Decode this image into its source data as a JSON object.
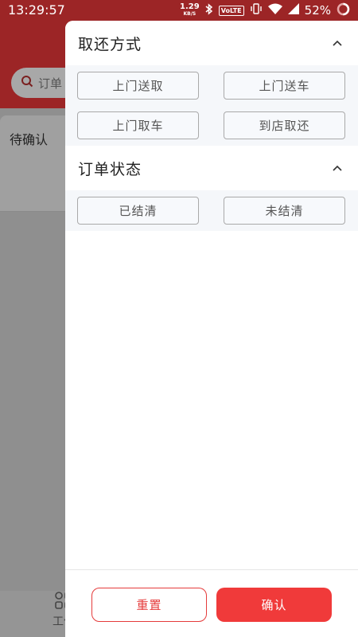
{
  "status_bar": {
    "time": "13:29:57",
    "net_speed": "1.29",
    "net_unit": "KB/S",
    "volte": "VoLTE",
    "battery": "52%"
  },
  "background": {
    "search_placeholder": "订单",
    "tab_label": "待确认",
    "nav_label": "工作"
  },
  "drawer": {
    "sections": [
      {
        "title": "取还方式",
        "options": [
          "上门送取",
          "上门送车",
          "上门取车",
          "到店取还"
        ]
      },
      {
        "title": "订单状态",
        "options": [
          "已结清",
          "未结清"
        ]
      }
    ],
    "reset_label": "重置",
    "confirm_label": "确认"
  },
  "colors": {
    "brand_red": "#9c2526",
    "accent_red": "#f03a3a"
  }
}
